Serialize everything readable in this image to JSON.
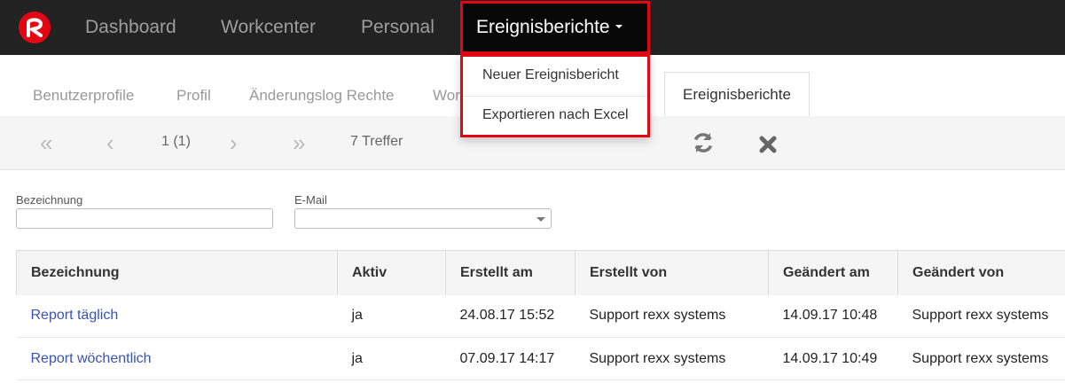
{
  "navbar": {
    "items": [
      "Dashboard",
      "Workcenter",
      "Personal"
    ],
    "active": "Ereignisberichte",
    "dropdown": [
      "Neuer Ereignisbericht",
      "Exportieren nach Excel"
    ]
  },
  "tabs": {
    "items": [
      "Benutzerprofile",
      "Profil",
      "Änderungslog Rechte",
      "Wor"
    ],
    "active": "Ereignisberichte"
  },
  "toolbar": {
    "page_info": "1 (1)",
    "hits": "7 Treffer"
  },
  "filters": {
    "name_label": "Bezeichnung",
    "email_label": "E-Mail"
  },
  "table": {
    "columns": [
      "Bezeichnung",
      "Aktiv",
      "Erstellt am",
      "Erstellt von",
      "Geändert am",
      "Geändert von"
    ],
    "rows": [
      [
        "Report täglich",
        "ja",
        "24.08.17 15:52",
        "Support rexx systems",
        "14.09.17 10:48",
        "Support rexx systems"
      ],
      [
        "Report wöchentlich",
        "ja",
        "07.09.17 14:17",
        "Support rexx systems",
        "14.09.17 10:49",
        "Support rexx systems"
      ]
    ]
  },
  "colors": {
    "navbar_bg": "#222222",
    "highlight": "#e30613",
    "link": "#3a52b4"
  }
}
